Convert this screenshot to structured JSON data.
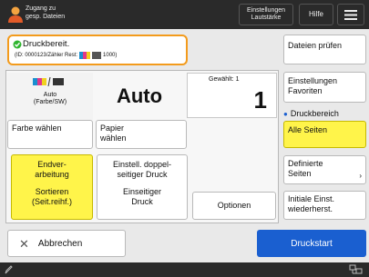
{
  "topbar": {
    "access_line1": "Zugang zu",
    "access_line2": "gesp. Dateien",
    "settings_line1": "Einstellungen",
    "settings_line2": "Lautstärke",
    "help_label": "Hilfe"
  },
  "status": {
    "ready_text": "Druckbereit.",
    "id_text": "(ID: 0000123/Zähler Rest:",
    "counter_text": "1000)"
  },
  "buttons": {
    "check_files": "Dateien prüfen",
    "favorites_line1": "Einstellungen",
    "favorites_line2": "Favoriten",
    "print_range_header": "Druckbereich",
    "all_pages": "Alle Seiten",
    "defined_pages_line1": "Definierte",
    "defined_pages_line2": "Seiten",
    "restore_line1": "Initiale Einst.",
    "restore_line2": "wiederherst.",
    "options": "Optionen",
    "cancel": "Abbrechen",
    "start": "Druckstart",
    "color_choose": "Farbe wählen",
    "paper_line1": "Papier",
    "paper_line2": "wählen",
    "finish_line1": "Endver-",
    "finish_line2": "arbeitung",
    "finish_value_line1": "Sortieren",
    "finish_value_line2": "(Seit.reihf.)",
    "duplex_line1": "Einstell. doppel-",
    "duplex_line2": "seitiger Druck",
    "duplex_value_line1": "Einseitiger",
    "duplex_value_line2": "Druck"
  },
  "color": {
    "small_line1": "Auto",
    "small_line2": "(Farbe/SW)",
    "big_value": "Auto"
  },
  "copies": {
    "label": "Gewählt: 1",
    "value": "1"
  },
  "colors": {
    "accent": "#1a5fd0",
    "highlight": "#fff44a",
    "status_border": "#f39b1c",
    "ready_green": "#2fb52f"
  }
}
